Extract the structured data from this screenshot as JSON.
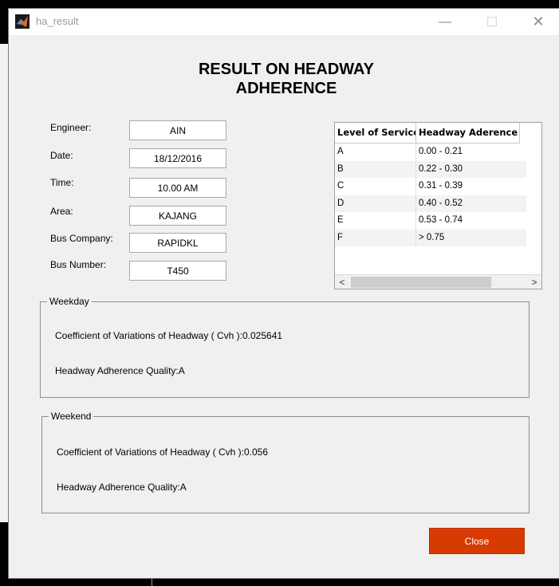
{
  "window": {
    "title": "ha_result",
    "minimize_glyph": "—",
    "maximize_glyph": "☐",
    "close_glyph": "✕"
  },
  "heading": "RESULT ON HEADWAY\nADHERENCE",
  "form": {
    "engineer_label": "Engineer:",
    "engineer_value": "AIN",
    "date_label": "Date:",
    "date_value": "18/12/2016",
    "time_label": "Time:",
    "time_value": "10.00 AM",
    "area_label": "Area:",
    "area_value": "KAJANG",
    "bus_company_label": "Bus Company:",
    "bus_company_value": "RAPIDKL",
    "bus_number_label": "Bus Number:",
    "bus_number_value": "T450"
  },
  "table": {
    "columns": [
      "Level of Service",
      "Headway Aderence"
    ],
    "rows": [
      [
        "A",
        "0.00 - 0.21"
      ],
      [
        "B",
        "0.22 - 0.30"
      ],
      [
        "C",
        "0.31 - 0.39"
      ],
      [
        "D",
        "0.40 - 0.52"
      ],
      [
        "E",
        "0.53 - 0.74"
      ],
      [
        "F",
        "> 0.75"
      ]
    ],
    "scroll_left_glyph": "<",
    "scroll_right_glyph": ">"
  },
  "weekday": {
    "legend": "Weekday",
    "cvh_text": "Coefficient of Variations of Headway ( Cvh ):0.025641",
    "quality_text": "Headway Adherence Quality:A"
  },
  "weekend": {
    "legend": "Weekend",
    "cvh_text": "Coefficient of Variations of Headway ( Cvh ):0.056",
    "quality_text": "Headway Adherence Quality:A"
  },
  "buttons": {
    "close_label": "Close"
  },
  "colors": {
    "close_button": "#d83b01",
    "window_bg": "#f0f0f0"
  },
  "icons": {
    "app_icon": "matlab-icon"
  }
}
